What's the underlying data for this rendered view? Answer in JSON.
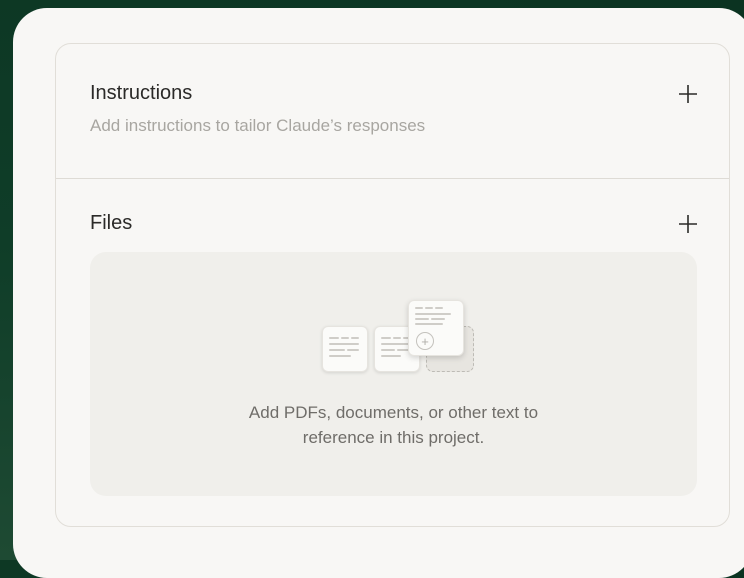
{
  "instructions": {
    "title": "Instructions",
    "subtitle": "Add instructions to tailor Claude’s responses",
    "add_icon": "plus-icon"
  },
  "files": {
    "title": "Files",
    "add_icon": "plus-icon",
    "dropzone_text_line1": "Add PDFs, documents, or other text to",
    "dropzone_text_line2": "reference in this project.",
    "illustration_icon": "documents-illustration"
  },
  "colors": {
    "background": "#0f3d28",
    "panel": "#f8f7f5",
    "dropzone": "#f0efeb"
  }
}
